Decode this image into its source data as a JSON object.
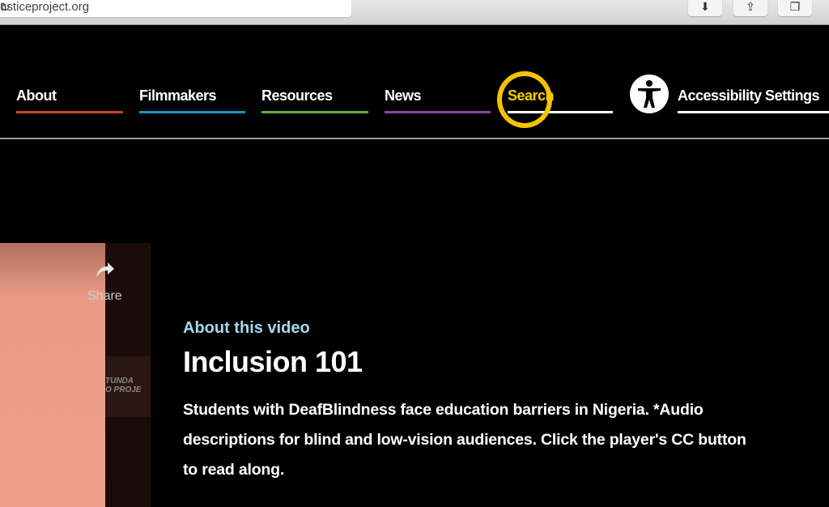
{
  "browser": {
    "url": "usticeproject.org",
    "reload_icon": "reload-icon",
    "buttons": [
      {
        "icon": "download-icon"
      },
      {
        "icon": "share-icon"
      },
      {
        "icon": "tabs-icon"
      }
    ]
  },
  "nav": {
    "items": [
      {
        "label": "About",
        "color": "#c8452b"
      },
      {
        "label": "Filmmakers",
        "color": "#1a95c8"
      },
      {
        "label": "Resources",
        "color": "#5fae3a"
      },
      {
        "label": "News",
        "color": "#8e44a8"
      },
      {
        "label": "Search",
        "color": "#ffffff",
        "text_color": "#f5d000"
      }
    ],
    "accessibility": {
      "label": "Accessibility Settings",
      "icon": "accessibility-icon"
    },
    "highlight_color": "#f5c400"
  },
  "video": {
    "share_label": "Share",
    "sign_text": "TUNDA\nO PROJE"
  },
  "about": {
    "eyebrow": "About this video",
    "title": "Inclusion 101",
    "description": "Students with DeafBlindness face education barriers in Nigeria. *Audio descriptions for blind and low-vision audiences. Click the player's CC button to read along."
  }
}
